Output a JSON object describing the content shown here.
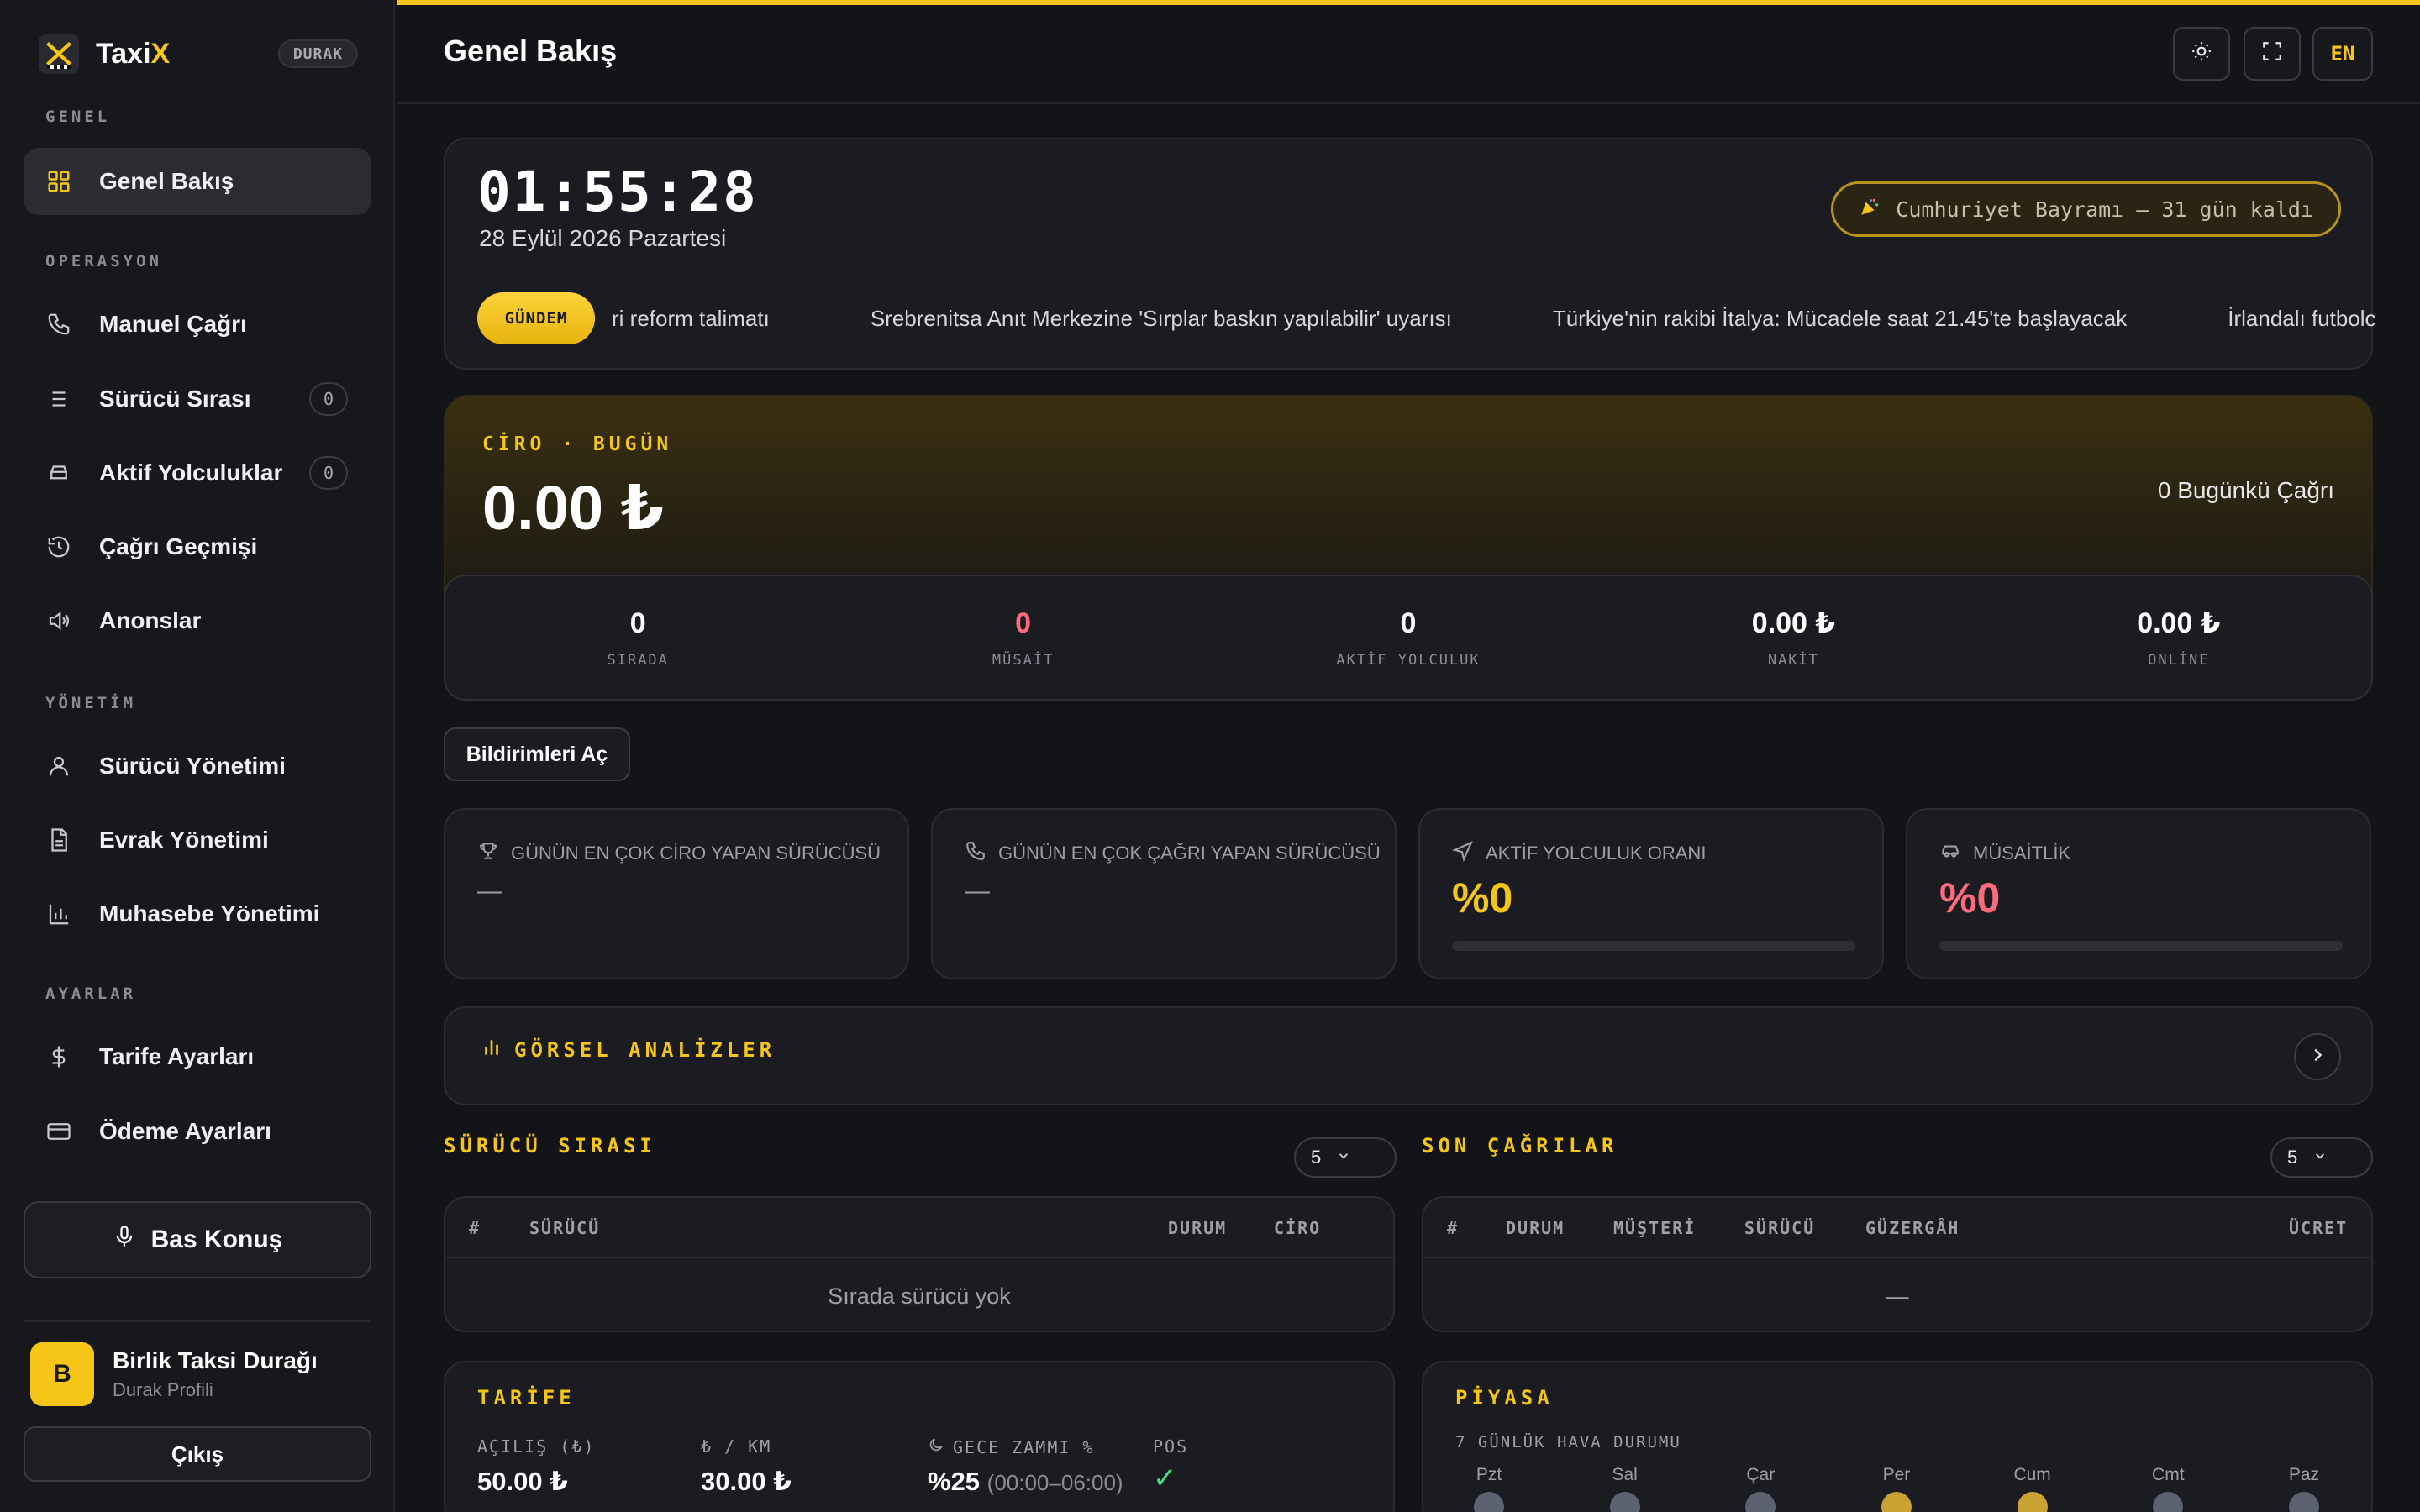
{
  "sidebar": {
    "brand": "Taxi",
    "brand_x": "X",
    "badge": "DURAK",
    "sections": {
      "general": "GENEL",
      "operations": "OPERASYON",
      "management": "YÖNETİM",
      "settings": "AYARLAR"
    },
    "items": {
      "overview": "Genel Bakış",
      "manual_call": "Manuel Çağrı",
      "driver_queue": "Sürücü Sırası",
      "driver_queue_count": "0",
      "active_rides": "Aktif Yolculuklar",
      "active_rides_count": "0",
      "call_history": "Çağrı Geçmişi",
      "announcements": "Anonslar",
      "driver_management": "Sürücü Yönetimi",
      "document_management": "Evrak Yönetimi",
      "accounting": "Muhasebe Yönetimi",
      "tariff_settings": "Tarife Ayarları",
      "payment_settings": "Ödeme Ayarları"
    },
    "push_to_talk": "Bas Konuş",
    "profile": {
      "initial": "B",
      "name": "Birlik Taksi Durağı",
      "role": "Durak Profili"
    },
    "logout": "Çıkış"
  },
  "header": {
    "title": "Genel Bakış",
    "lang": "EN"
  },
  "clock": {
    "time": "01:55:28",
    "date": "28 Eylül 2026 Pazartesi",
    "holiday": "Cumhuriyet Bayramı — 31 gün kaldı"
  },
  "ticker": {
    "badge": "GÜNDEM",
    "items": [
      "ri reform talimatı",
      "Srebrenitsa Anıt Merkezine 'Sırplar baskın yapılabilir' uyarısı",
      "Türkiye'nin rakibi İtalya: Mücadele saat 21.45'te başlayacak",
      "İrlandalı futbolc"
    ]
  },
  "revenue": {
    "label": "CİRO · BUGÜN",
    "value": "0.00 ₺",
    "calls": "0 Bugünkü Çağrı"
  },
  "stats": [
    {
      "value": "0",
      "label": "SIRADA"
    },
    {
      "value": "0",
      "label": "MÜSAİT"
    },
    {
      "value": "0",
      "label": "AKTİF YOLCULUK"
    },
    {
      "value": "0.00 ₺",
      "label": "NAKİT"
    },
    {
      "value": "0.00 ₺",
      "label": "ONLİNE"
    }
  ],
  "notifications_button": "Bildirimleri Aç",
  "kpis": {
    "top_revenue": {
      "title": "GÜNÜN EN ÇOK CİRO YAPAN SÜRÜCÜSÜ",
      "value": "—"
    },
    "top_calls": {
      "title": "GÜNÜN EN ÇOK ÇAĞRI YAPAN SÜRÜCÜSÜ",
      "value": "—"
    },
    "active_ratio": {
      "title": "AKTİF YOLCULUK ORANI",
      "value": "%0",
      "progress": 0
    },
    "availability": {
      "title": "MÜSAİTLİK",
      "value": "%0",
      "progress": 0
    }
  },
  "analytics": {
    "title": "GÖRSEL ANALİZLER"
  },
  "driver_queue": {
    "title": "SÜRÜCÜ SIRASI",
    "page_size": "5",
    "columns": [
      "#",
      "SÜRÜCÜ",
      "DURUM",
      "CİRO"
    ],
    "empty": "Sırada sürücü yok"
  },
  "recent_calls": {
    "title": "SON ÇAĞRILAR",
    "page_size": "5",
    "columns": [
      "#",
      "DURUM",
      "MÜŞTERİ",
      "SÜRÜCÜ",
      "GÜZERGÂH",
      "ÜCRET"
    ],
    "empty": "—"
  },
  "tariff": {
    "title": "TARİFE",
    "opening_label": "AÇILIŞ (₺)",
    "opening_value": "50.00 ₺",
    "per_km_label": "₺ / KM",
    "per_km_value": "30.00 ₺",
    "night_label": "GECE ZAMMI %",
    "night_value": "%25",
    "night_hours": "(00:00–06:00)",
    "pos_label": "POS",
    "pos_value": "✓"
  },
  "market": {
    "title": "PİYASA",
    "weather_title": "7 GÜNLÜK HAVA DURUMU",
    "days": [
      "Pzt",
      "Sal",
      "Çar",
      "Per",
      "Cum",
      "Cmt",
      "Paz"
    ]
  },
  "colors": {
    "accent": "#f5c518",
    "danger": "#ff6b7d",
    "success": "#4ade80",
    "background": "#131418"
  }
}
